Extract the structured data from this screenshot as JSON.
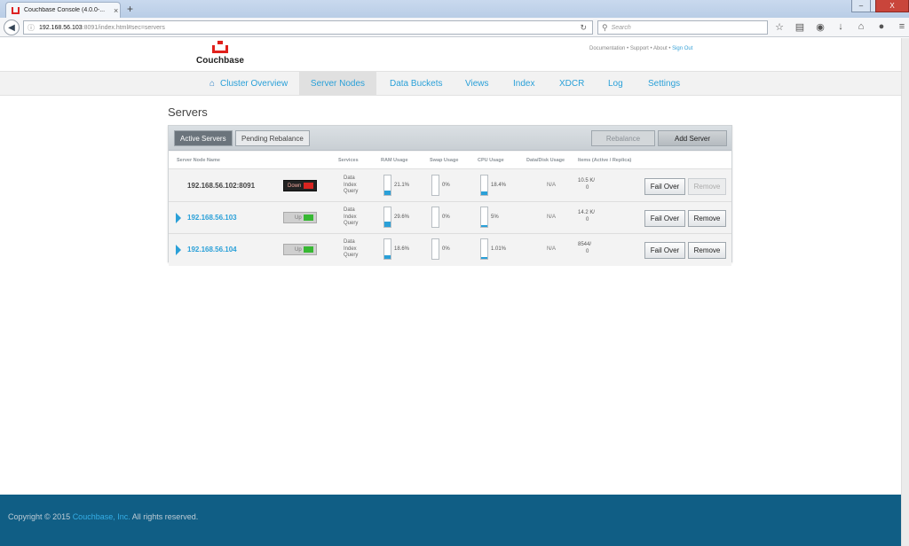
{
  "browser": {
    "tab_title": "Couchbase Console (4.0.0-...",
    "tab_close": "×",
    "new_tab": "+",
    "url_host": "192.168.56.103",
    "url_path": ":8091/index.html#sec=servers",
    "search_placeholder": "Search",
    "window_controls": [
      "–",
      "□",
      "X"
    ]
  },
  "header": {
    "brand": "Couchbase",
    "links": {
      "documentation": "Documentation",
      "support": "Support",
      "about": "About",
      "signout": "Sign Out",
      "separator": "•"
    }
  },
  "nav": {
    "items": [
      {
        "label": "Cluster Overview"
      },
      {
        "label": "Server Nodes"
      },
      {
        "label": "Data Buckets"
      },
      {
        "label": "Views"
      },
      {
        "label": "Index"
      },
      {
        "label": "XDCR"
      },
      {
        "label": "Log"
      },
      {
        "label": "Settings"
      }
    ],
    "active": "Server Nodes"
  },
  "servers": {
    "title": "Servers",
    "tabs": {
      "active": "Active Servers",
      "pending": "Pending Rebalance"
    },
    "rebalance_label": "Rebalance",
    "add_server_label": "Add Server",
    "columns": {
      "name": "Server Node Name",
      "services": "Services",
      "ram": "RAM Usage",
      "swap": "Swap Usage",
      "cpu": "CPU Usage",
      "disk": "Data/Disk Usage",
      "items": "Items (Active / Replica)"
    },
    "rows": [
      {
        "host": "192.168.56.102:8091",
        "status": "Down",
        "services": [
          "Data",
          "Index",
          "Query"
        ],
        "ram": "21.1%",
        "ram_level": 0.211,
        "swap": "0%",
        "swap_level": 0,
        "cpu": "18.4%",
        "cpu_level": 0.184,
        "disk": "N/A",
        "items_active": "10.5 K/",
        "items_replica": "0",
        "failover_label": "Fail Over",
        "remove_label": "Remove"
      },
      {
        "host": "192.168.56.103",
        "status": "Up",
        "services": [
          "Data",
          "Index",
          "Query"
        ],
        "ram": "29.6%",
        "ram_level": 0.296,
        "swap": "0%",
        "swap_level": 0,
        "cpu": "5%",
        "cpu_level": 0.05,
        "disk": "N/A",
        "items_active": "14.2 K/",
        "items_replica": "0",
        "failover_label": "Fail Over",
        "remove_label": "Remove"
      },
      {
        "host": "192.168.56.104",
        "status": "Up",
        "services": [
          "Data",
          "Index",
          "Query"
        ],
        "ram": "18.6%",
        "ram_level": 0.186,
        "swap": "0%",
        "swap_level": 0,
        "cpu": "1.01%",
        "cpu_level": 0.0101,
        "disk": "N/A",
        "items_active": "8544/",
        "items_replica": "0",
        "failover_label": "Fail Over",
        "remove_label": "Remove"
      }
    ]
  },
  "footer": {
    "prefix": "Copyright © 2015 ",
    "company": "Couchbase, Inc.",
    "suffix": " All rights reserved."
  }
}
